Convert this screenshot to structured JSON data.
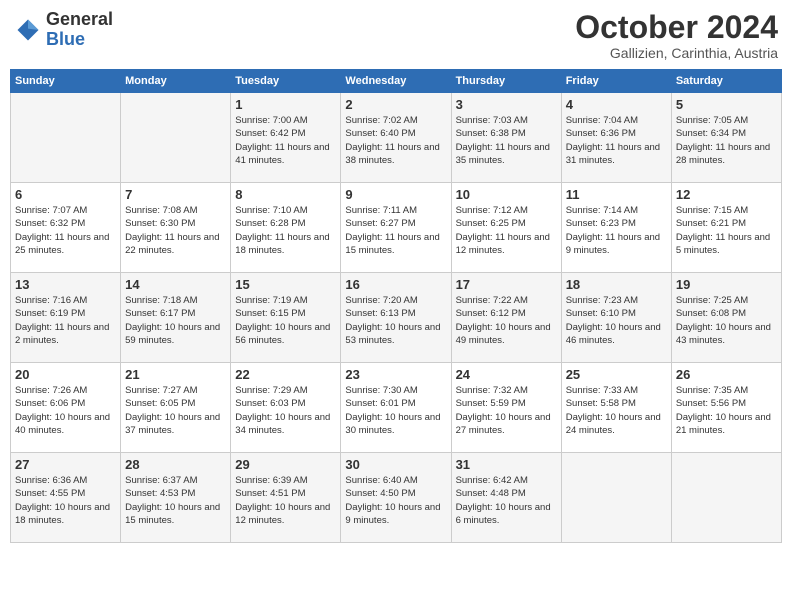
{
  "header": {
    "logo_general": "General",
    "logo_blue": "Blue",
    "month_year": "October 2024",
    "location": "Gallizien, Carinthia, Austria"
  },
  "calendar": {
    "days_of_week": [
      "Sunday",
      "Monday",
      "Tuesday",
      "Wednesday",
      "Thursday",
      "Friday",
      "Saturday"
    ],
    "weeks": [
      [
        {
          "day": "",
          "info": ""
        },
        {
          "day": "",
          "info": ""
        },
        {
          "day": "1",
          "info": "Sunrise: 7:00 AM\nSunset: 6:42 PM\nDaylight: 11 hours and 41 minutes."
        },
        {
          "day": "2",
          "info": "Sunrise: 7:02 AM\nSunset: 6:40 PM\nDaylight: 11 hours and 38 minutes."
        },
        {
          "day": "3",
          "info": "Sunrise: 7:03 AM\nSunset: 6:38 PM\nDaylight: 11 hours and 35 minutes."
        },
        {
          "day": "4",
          "info": "Sunrise: 7:04 AM\nSunset: 6:36 PM\nDaylight: 11 hours and 31 minutes."
        },
        {
          "day": "5",
          "info": "Sunrise: 7:05 AM\nSunset: 6:34 PM\nDaylight: 11 hours and 28 minutes."
        }
      ],
      [
        {
          "day": "6",
          "info": "Sunrise: 7:07 AM\nSunset: 6:32 PM\nDaylight: 11 hours and 25 minutes."
        },
        {
          "day": "7",
          "info": "Sunrise: 7:08 AM\nSunset: 6:30 PM\nDaylight: 11 hours and 22 minutes."
        },
        {
          "day": "8",
          "info": "Sunrise: 7:10 AM\nSunset: 6:28 PM\nDaylight: 11 hours and 18 minutes."
        },
        {
          "day": "9",
          "info": "Sunrise: 7:11 AM\nSunset: 6:27 PM\nDaylight: 11 hours and 15 minutes."
        },
        {
          "day": "10",
          "info": "Sunrise: 7:12 AM\nSunset: 6:25 PM\nDaylight: 11 hours and 12 minutes."
        },
        {
          "day": "11",
          "info": "Sunrise: 7:14 AM\nSunset: 6:23 PM\nDaylight: 11 hours and 9 minutes."
        },
        {
          "day": "12",
          "info": "Sunrise: 7:15 AM\nSunset: 6:21 PM\nDaylight: 11 hours and 5 minutes."
        }
      ],
      [
        {
          "day": "13",
          "info": "Sunrise: 7:16 AM\nSunset: 6:19 PM\nDaylight: 11 hours and 2 minutes."
        },
        {
          "day": "14",
          "info": "Sunrise: 7:18 AM\nSunset: 6:17 PM\nDaylight: 10 hours and 59 minutes."
        },
        {
          "day": "15",
          "info": "Sunrise: 7:19 AM\nSunset: 6:15 PM\nDaylight: 10 hours and 56 minutes."
        },
        {
          "day": "16",
          "info": "Sunrise: 7:20 AM\nSunset: 6:13 PM\nDaylight: 10 hours and 53 minutes."
        },
        {
          "day": "17",
          "info": "Sunrise: 7:22 AM\nSunset: 6:12 PM\nDaylight: 10 hours and 49 minutes."
        },
        {
          "day": "18",
          "info": "Sunrise: 7:23 AM\nSunset: 6:10 PM\nDaylight: 10 hours and 46 minutes."
        },
        {
          "day": "19",
          "info": "Sunrise: 7:25 AM\nSunset: 6:08 PM\nDaylight: 10 hours and 43 minutes."
        }
      ],
      [
        {
          "day": "20",
          "info": "Sunrise: 7:26 AM\nSunset: 6:06 PM\nDaylight: 10 hours and 40 minutes."
        },
        {
          "day": "21",
          "info": "Sunrise: 7:27 AM\nSunset: 6:05 PM\nDaylight: 10 hours and 37 minutes."
        },
        {
          "day": "22",
          "info": "Sunrise: 7:29 AM\nSunset: 6:03 PM\nDaylight: 10 hours and 34 minutes."
        },
        {
          "day": "23",
          "info": "Sunrise: 7:30 AM\nSunset: 6:01 PM\nDaylight: 10 hours and 30 minutes."
        },
        {
          "day": "24",
          "info": "Sunrise: 7:32 AM\nSunset: 5:59 PM\nDaylight: 10 hours and 27 minutes."
        },
        {
          "day": "25",
          "info": "Sunrise: 7:33 AM\nSunset: 5:58 PM\nDaylight: 10 hours and 24 minutes."
        },
        {
          "day": "26",
          "info": "Sunrise: 7:35 AM\nSunset: 5:56 PM\nDaylight: 10 hours and 21 minutes."
        }
      ],
      [
        {
          "day": "27",
          "info": "Sunrise: 6:36 AM\nSunset: 4:55 PM\nDaylight: 10 hours and 18 minutes."
        },
        {
          "day": "28",
          "info": "Sunrise: 6:37 AM\nSunset: 4:53 PM\nDaylight: 10 hours and 15 minutes."
        },
        {
          "day": "29",
          "info": "Sunrise: 6:39 AM\nSunset: 4:51 PM\nDaylight: 10 hours and 12 minutes."
        },
        {
          "day": "30",
          "info": "Sunrise: 6:40 AM\nSunset: 4:50 PM\nDaylight: 10 hours and 9 minutes."
        },
        {
          "day": "31",
          "info": "Sunrise: 6:42 AM\nSunset: 4:48 PM\nDaylight: 10 hours and 6 minutes."
        },
        {
          "day": "",
          "info": ""
        },
        {
          "day": "",
          "info": ""
        }
      ]
    ]
  }
}
